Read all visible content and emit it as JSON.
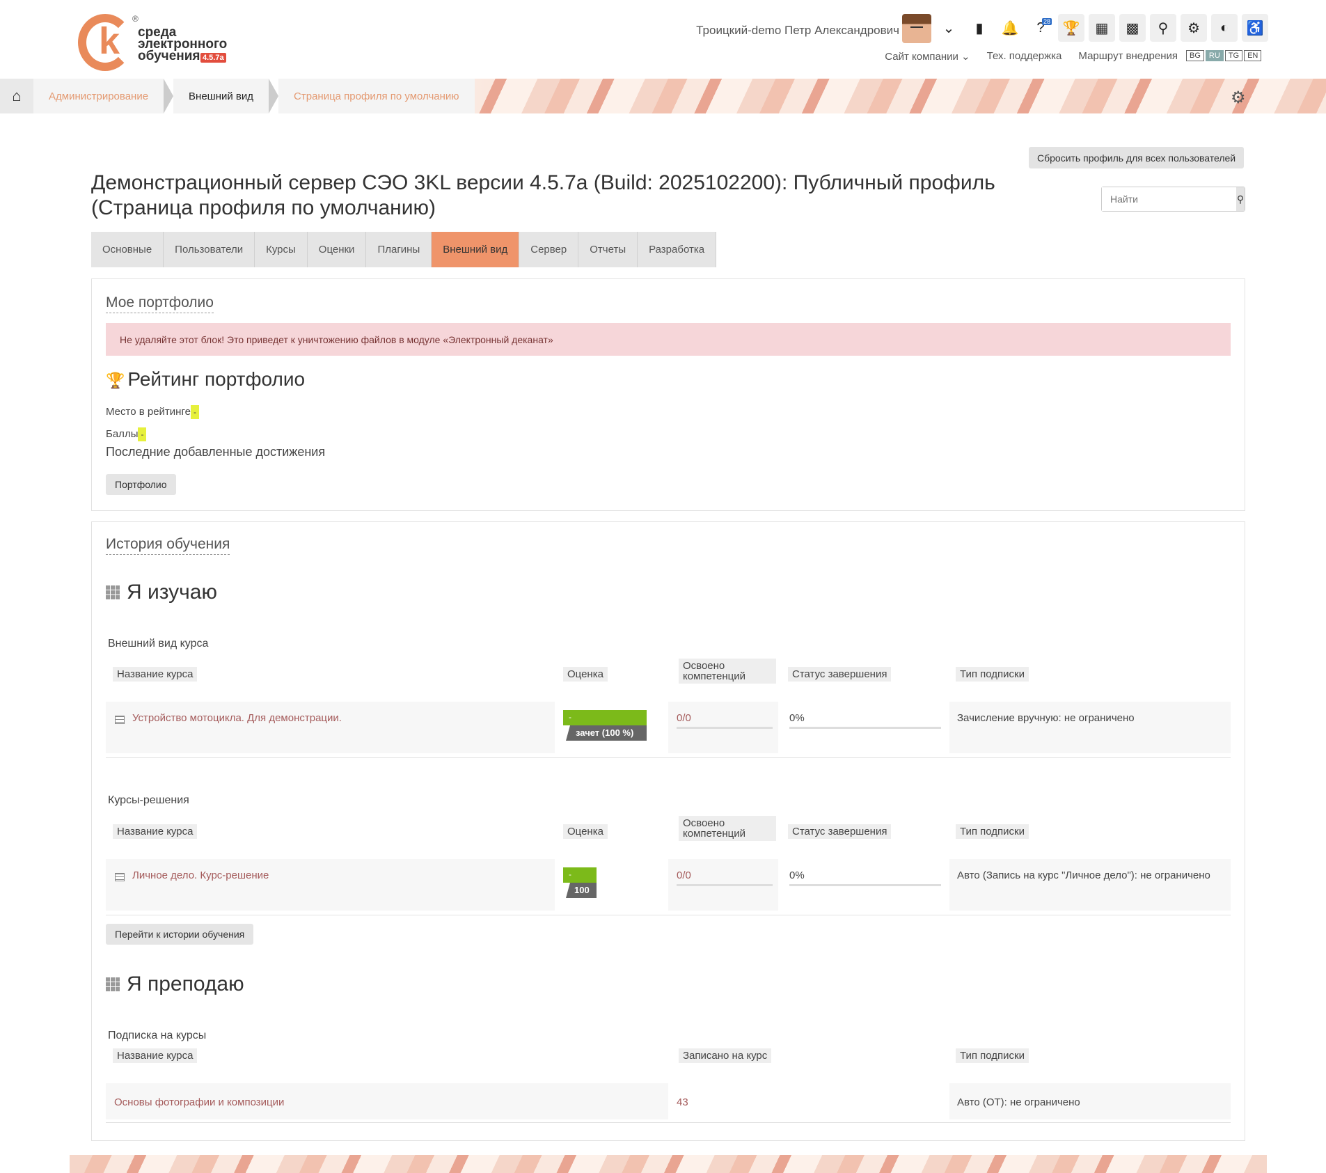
{
  "header": {
    "logo": {
      "line1": "среда",
      "line2": "электронного",
      "line3": "обучения",
      "version": "4.5.7a",
      "reg": "®"
    },
    "user_name": "Троицкий-demo Петр Александрович",
    "icons": [
      "chevron-down-icon",
      "chat-icon",
      "bell-icon",
      "help-icon",
      "trophy-icon",
      "dashboard-icon",
      "structure-icon",
      "search-icon",
      "gear-icon",
      "toggle-icon",
      "accessibility-icon"
    ],
    "help_badge": "28",
    "links": {
      "company": "Сайт компании",
      "support": "Тех. поддержка",
      "route": "Маршрут внедрения"
    },
    "languages": [
      "BG",
      "RU",
      "TG",
      "EN"
    ],
    "active_language": "RU"
  },
  "breadcrumb": {
    "items": [
      "Администрирование",
      "Внешний вид",
      "Страница профиля по умолчанию"
    ]
  },
  "page": {
    "reset_button": "Сбросить профиль для всех пользователей",
    "search_placeholder": "Найти",
    "title": "Демонстрационный сервер СЭО 3KL версии 4.5.7a (Build: 2025102200): Публичный профиль (Страница профиля по умолчанию)",
    "tabs": [
      "Основные",
      "Пользователи",
      "Курсы",
      "Оценки",
      "Плагины",
      "Внешний вид",
      "Сервер",
      "Отчеты",
      "Разработка"
    ],
    "active_tab": "Внешний вид"
  },
  "portfolio": {
    "title": "Мое портфолио",
    "alert": "Не удаляйте этот блок! Это приведет к уничтожению файлов в модуле «Электронный деканат»",
    "rating_title": "Рейтинг портфолио",
    "place_label": "Место в рейтинге",
    "place_value": "-",
    "points_label": "Баллы",
    "points_value": "-",
    "recent_label": "Последние добавленные достижения",
    "button": "Портфолио"
  },
  "history": {
    "title": "История обучения",
    "studying_title": "Я изучаю",
    "columns": {
      "name": "Название курса",
      "grade": "Оценка",
      "competencies": "Освоено компетенций",
      "status": "Статус завершения",
      "subscription": "Тип подписки",
      "enrolled": "Записано на курс"
    },
    "group1": {
      "title": "Внешний вид курса",
      "row": {
        "name": "Устройство мотоцикла. Для демонстрации.",
        "grade_top": "-",
        "grade_bottom": "зачет (100 %)",
        "competencies": "0/0",
        "status": "0%",
        "subscription": "Зачисление вручную: не ограничено"
      }
    },
    "group2": {
      "title": "Курсы-решения",
      "row": {
        "name": "Личное дело. Курс-решение",
        "grade_top": "-",
        "grade_bottom": "100",
        "competencies": "0/0",
        "status": "0%",
        "subscription": "Авто (Запись на курс \"Личное дело\"): не ограничено"
      }
    },
    "history_button": "Перейти к истории обучения",
    "teaching_title": "Я преподаю",
    "group3": {
      "title": "Подписка на курсы",
      "row": {
        "name": "Основы фотографии и композиции",
        "enrolled": "43",
        "subscription": "Авто (ОТ): не ограничено"
      }
    }
  }
}
